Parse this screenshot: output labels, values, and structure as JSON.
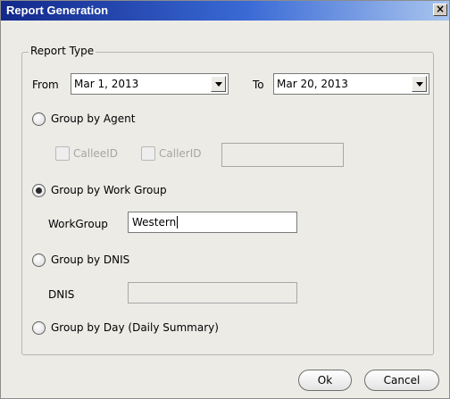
{
  "window": {
    "title": "Report Generation",
    "close_label": "×"
  },
  "report_type": {
    "legend": "Report Type",
    "from_label": "From",
    "from_value": "Mar 1, 2013",
    "to_label": "To",
    "to_value": "Mar 20, 2013"
  },
  "options": {
    "group_by_agent": {
      "label": "Group by Agent",
      "selected": false
    },
    "callee_label": "CalleeID",
    "caller_label": "CallerID",
    "agent_value": "",
    "group_by_workgroup": {
      "label": "Group by Work Group",
      "selected": true
    },
    "workgroup_label": "WorkGroup",
    "workgroup_value": "Western",
    "group_by_dnis": {
      "label": "Group by DNIS",
      "selected": false
    },
    "dnis_label": "DNIS",
    "dnis_value": "",
    "group_by_day": {
      "label": "Group by Day (Daily Summary)",
      "selected": false
    }
  },
  "buttons": {
    "ok": "Ok",
    "cancel": "Cancel"
  }
}
